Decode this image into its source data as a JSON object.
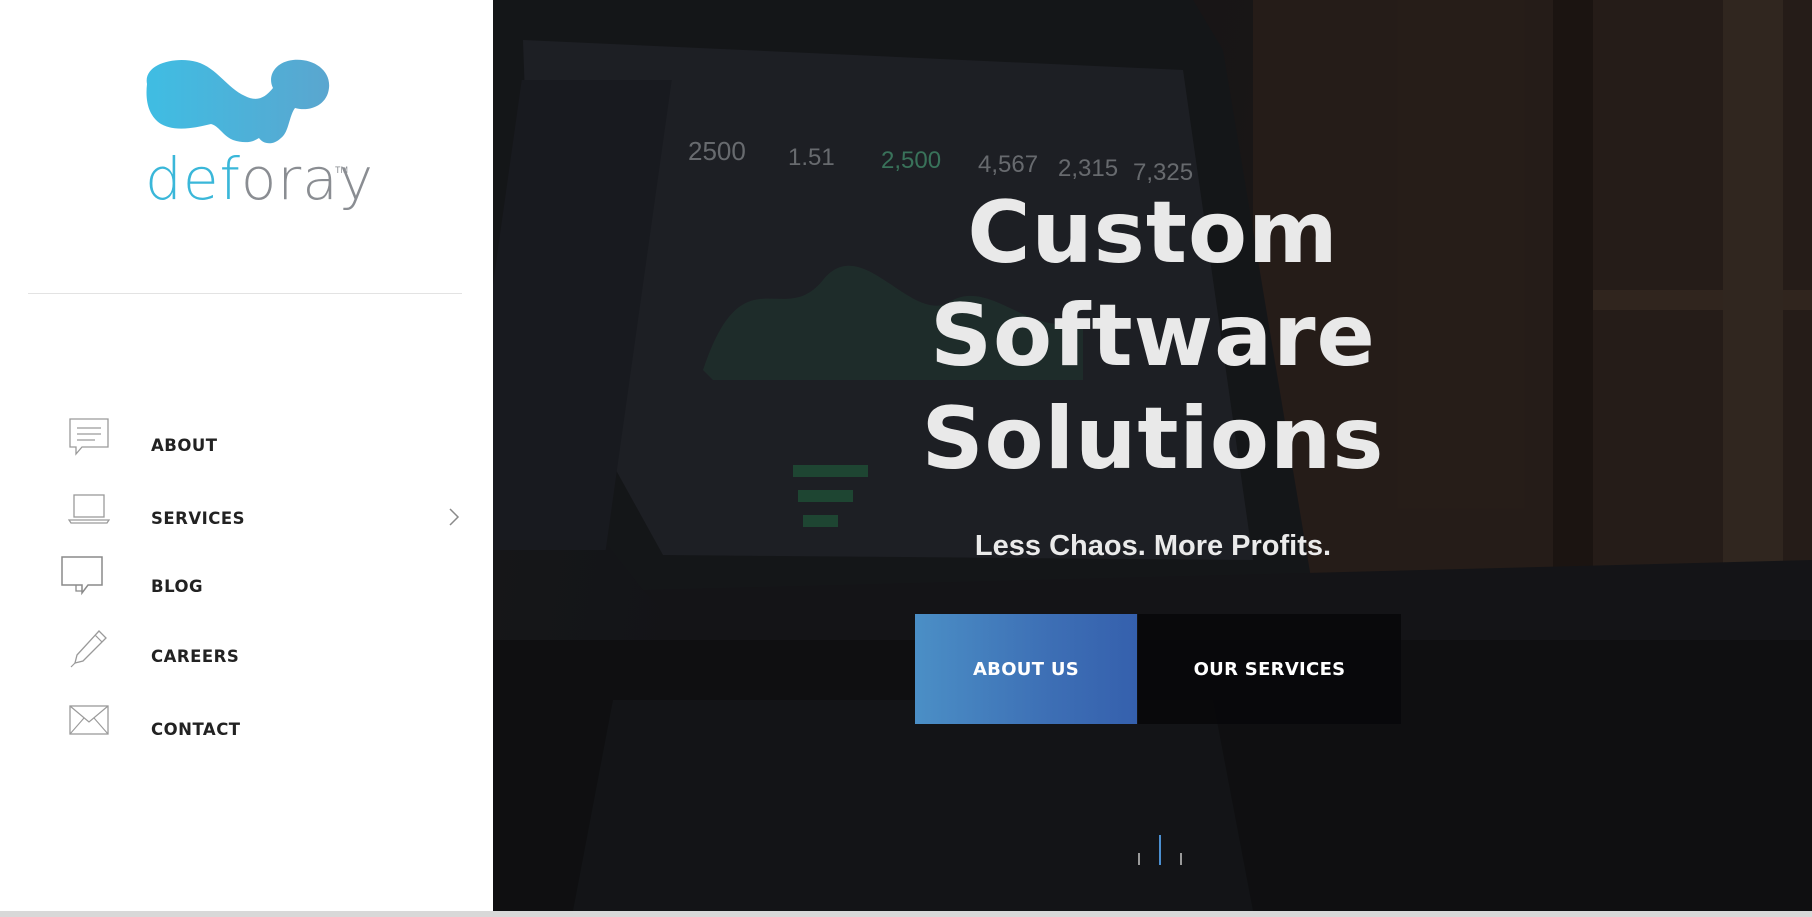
{
  "brand": {
    "name_part1": "def",
    "name_part2": "o",
    "name_part3": "ray",
    "trademark": "TM",
    "logo_color": "#3ab7d9",
    "text_color": "#8a8d92"
  },
  "nav": {
    "items": [
      {
        "label": "ABOUT",
        "icon": "speech-bubble-lines-icon"
      },
      {
        "label": "SERVICES",
        "icon": "laptop-icon",
        "has_submenu": true
      },
      {
        "label": "BLOG",
        "icon": "chat-bubbles-icon"
      },
      {
        "label": "CAREERS",
        "icon": "pen-icon"
      },
      {
        "label": "CONTACT",
        "icon": "envelope-icon"
      }
    ]
  },
  "hero": {
    "title_line1": "Custom",
    "title_line2": "Software",
    "title_line3": "Solutions",
    "subtitle": "Less Chaos. More Profits.",
    "primary_button": "ABOUT US",
    "secondary_button": "OUR SERVICES",
    "primary_color": "#4b8fc6",
    "active_slide": 2,
    "slide_count": 3
  }
}
